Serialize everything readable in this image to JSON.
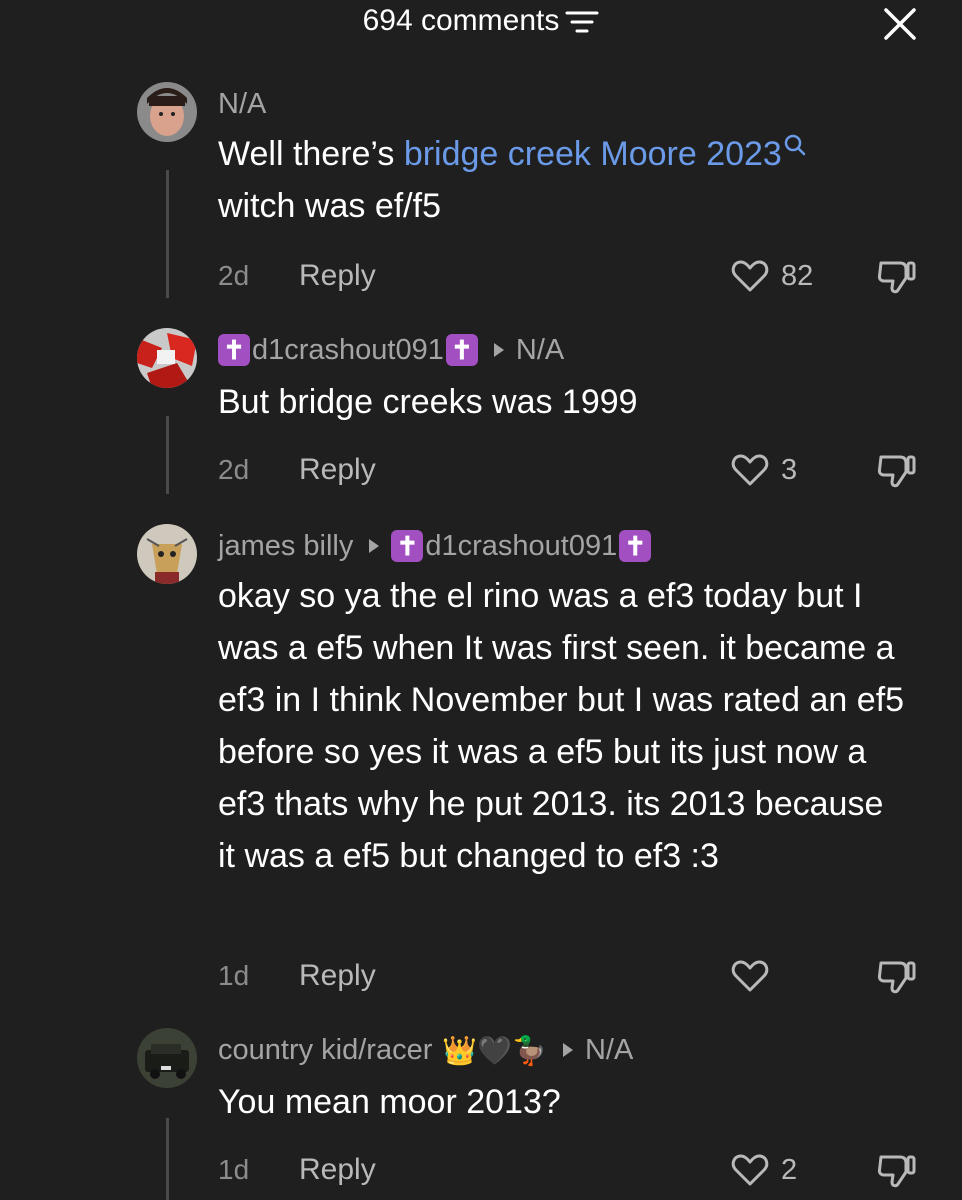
{
  "header": {
    "title": "694 comments"
  },
  "comments": [
    {
      "author": "N/A",
      "text_plain_before": "Well there’s ",
      "link_text": "bridge creek Moore 2023",
      "text_after": "witch was ef/f5",
      "time": "2d",
      "reply_label": "Reply",
      "likes": "82"
    },
    {
      "author": "d1crashout091",
      "reply_to": "N/A",
      "text": "But bridge creeks was 1999",
      "time": "2d",
      "reply_label": "Reply",
      "likes": "3"
    },
    {
      "author": "james billy",
      "reply_to": "d1crashout091",
      "text": "okay so ya the el rino was a ef3 today but I was a ef5 when It was first seen. it became a ef3 in I think November but I was rated an ef5 before so yes it was a ef5 but its just now a ef3 thats why he put 2013. its 2013 because it was a ef5 but changed to ef3 :3",
      "time": "1d",
      "reply_label": "Reply",
      "likes": ""
    },
    {
      "author": "country kid/racer",
      "author_emojis": "👑🖤🦆",
      "reply_to": "N/A",
      "text": "You mean moor 2013?",
      "time": "1d",
      "reply_label": "Reply",
      "likes": "2"
    }
  ],
  "badge_glyph": "✝",
  "colors": {
    "background": "#1f1f1f",
    "link": "#6b9be8",
    "muted": "#a4a4a4",
    "badge": "#a14fc1"
  },
  "icons": [
    "sort-icon",
    "close-icon",
    "heart-icon",
    "dislike-icon",
    "search-icon",
    "reply-arrow-icon"
  ]
}
